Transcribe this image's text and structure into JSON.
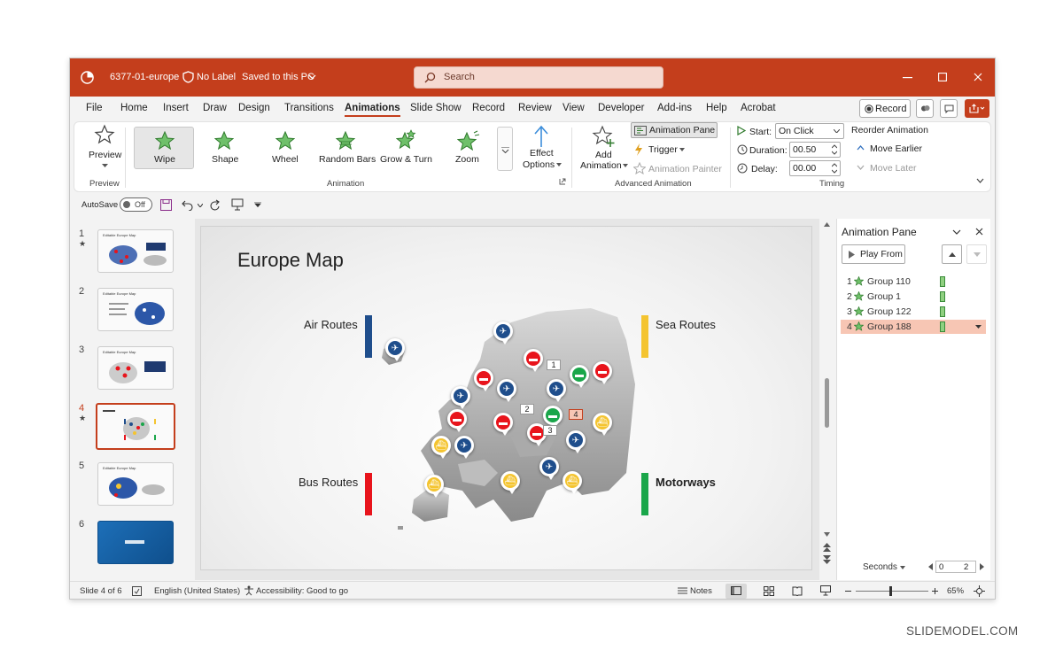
{
  "title_bar": {
    "file_name": "6377-01-europe",
    "label": "No Label",
    "save_status": "Saved to this PC",
    "search_placeholder": "Search"
  },
  "menu": {
    "tabs": [
      "File",
      "Home",
      "Insert",
      "Draw",
      "Design",
      "Transitions",
      "Animations",
      "Slide Show",
      "Record",
      "Review",
      "View",
      "Developer",
      "Add-ins",
      "Help",
      "Acrobat"
    ],
    "active": "Animations",
    "record_label": "Record"
  },
  "ribbon": {
    "preview": {
      "label": "Preview",
      "group": "Preview"
    },
    "animations": [
      "Wipe",
      "Shape",
      "Wheel",
      "Random Bars",
      "Grow & Turn",
      "Zoom"
    ],
    "animation_group": "Animation",
    "effect_options": [
      "Effect",
      "Options"
    ],
    "add_animation": [
      "Add",
      "Animation"
    ],
    "animation_pane": "Animation Pane",
    "trigger": "Trigger",
    "animation_painter": "Animation Painter",
    "advanced_group": "Advanced Animation",
    "start_label": "Start:",
    "start_value": "On Click",
    "duration_label": "Duration:",
    "duration_value": "00.50",
    "delay_label": "Delay:",
    "delay_value": "00.00",
    "reorder_title": "Reorder Animation",
    "move_earlier": "Move Earlier",
    "move_later": "Move Later",
    "timing_group": "Timing",
    "accent_color": "#c43e1c"
  },
  "qat": {
    "autosave_label": "AutoSave",
    "toggle_state": "Off"
  },
  "slides": {
    "numbers": [
      "1",
      "2",
      "3",
      "4",
      "5",
      "6"
    ],
    "selected": 4,
    "thumb_title": "Editable Europe Map"
  },
  "slide": {
    "title": "Europe Map",
    "labels": {
      "air": "Air Routes",
      "sea": "Sea Routes",
      "bus": "Bus Routes",
      "motorways": "Motorways"
    },
    "tags": [
      "1",
      "2",
      "3",
      "4"
    ],
    "colors": {
      "air": "#1f4e8c",
      "sea": "#f4c430",
      "bus": "#e8141c",
      "motorways": "#1aa64a"
    }
  },
  "animation_pane": {
    "title": "Animation Pane",
    "play_from": "Play From",
    "items": [
      {
        "num": "1",
        "name": "Group 110"
      },
      {
        "num": "2",
        "name": "Group 1"
      },
      {
        "num": "3",
        "name": "Group 122"
      },
      {
        "num": "4",
        "name": "Group 188"
      }
    ],
    "selected_item": 4,
    "seconds_label": "Seconds",
    "timeline_start": "0",
    "timeline_end": "2"
  },
  "status_bar": {
    "slide_info": "Slide 4 of 6",
    "language": "English (United States)",
    "accessibility": "Accessibility: Good to go",
    "notes": "Notes",
    "zoom": "65%"
  },
  "watermark": "SLIDEMODEL.COM"
}
